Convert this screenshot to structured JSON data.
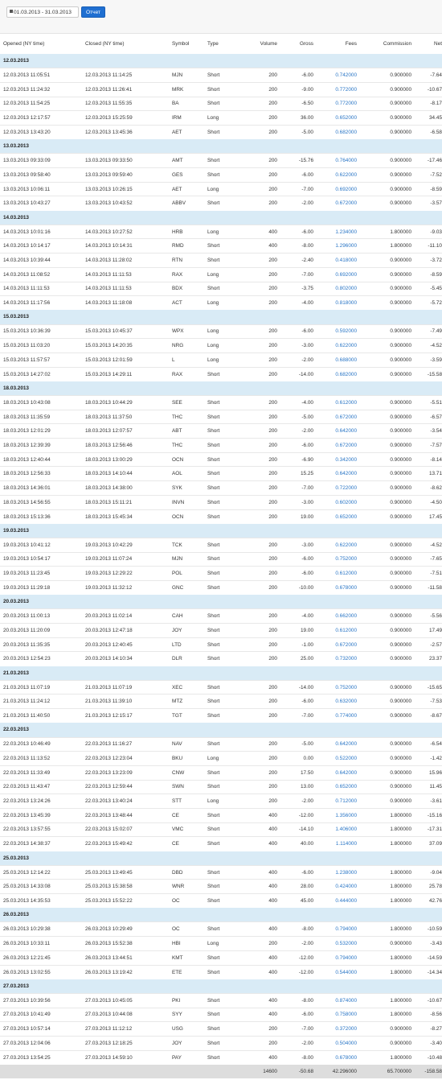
{
  "toolbar": {
    "date_range": "01.03.2013 - 31.03.2013",
    "report_label": "Отчет",
    "calendar_icon": "calendar-icon"
  },
  "headers": [
    "Opened (NY time)",
    "Closed (NY time)",
    "Symbol",
    "Type",
    "Volume",
    "Gross",
    "Fees",
    "Commission",
    "Net"
  ],
  "groups": [
    {
      "date": "12.03.2013",
      "rows": [
        [
          "12.03.2013 11:05:51",
          "12.03.2013 11:14:25",
          "MJN",
          "Short",
          "200",
          "-6.00",
          "0.742000",
          "0.900000",
          "-7.64"
        ],
        [
          "12.03.2013 11:24:32",
          "12.03.2013 11:26:41",
          "MRK",
          "Short",
          "200",
          "-9.00",
          "0.772000",
          "0.900000",
          "-10.67"
        ],
        [
          "12.03.2013 11:54:25",
          "12.03.2013 11:55:35",
          "BA",
          "Short",
          "200",
          "-6.50",
          "0.772000",
          "0.900000",
          "-8.17"
        ],
        [
          "12.03.2013 12:17:57",
          "12.03.2013 15:25:59",
          "IRM",
          "Long",
          "200",
          "36.00",
          "0.652000",
          "0.900000",
          "34.45"
        ],
        [
          "12.03.2013 13:43:20",
          "12.03.2013 13:45:36",
          "AET",
          "Short",
          "200",
          "-5.00",
          "0.682000",
          "0.900000",
          "-6.58"
        ]
      ]
    },
    {
      "date": "13.03.2013",
      "rows": [
        [
          "13.03.2013 09:33:09",
          "13.03.2013 09:33:50",
          "AMT",
          "Short",
          "200",
          "-15.76",
          "0.764000",
          "0.900000",
          "-17.46"
        ],
        [
          "13.03.2013 09:58:40",
          "13.03.2013 09:59:40",
          "GES",
          "Short",
          "200",
          "-6.00",
          "0.622000",
          "0.900000",
          "-7.52"
        ],
        [
          "13.03.2013 10:06:11",
          "13.03.2013 10:26:15",
          "AET",
          "Long",
          "200",
          "-7.00",
          "0.692000",
          "0.900000",
          "-8.59"
        ],
        [
          "13.03.2013 10:43:27",
          "13.03.2013 10:43:52",
          "ABBV",
          "Short",
          "200",
          "-2.00",
          "0.672000",
          "0.900000",
          "-3.57"
        ]
      ]
    },
    {
      "date": "14.03.2013",
      "rows": [
        [
          "14.03.2013 10:01:16",
          "14.03.2013 10:27:52",
          "HRB",
          "Long",
          "400",
          "-6.00",
          "1.234000",
          "1.800000",
          "-9.03"
        ],
        [
          "14.03.2013 10:14:17",
          "14.03.2013 10:14:31",
          "RMD",
          "Short",
          "400",
          "-8.00",
          "1.296000",
          "1.800000",
          "-11.10"
        ],
        [
          "14.03.2013 10:39:44",
          "14.03.2013 11:28:02",
          "RTN",
          "Short",
          "200",
          "-2.40",
          "0.418000",
          "0.900000",
          "-3.72"
        ],
        [
          "14.03.2013 11:08:52",
          "14.03.2013 11:11:53",
          "RAX",
          "Long",
          "200",
          "-7.00",
          "0.692000",
          "0.900000",
          "-8.59"
        ],
        [
          "14.03.2013 11:11:53",
          "14.03.2013 11:11:53",
          "BDX",
          "Short",
          "200",
          "-3.75",
          "0.802000",
          "0.900000",
          "-5.45"
        ],
        [
          "14.03.2013 11:17:56",
          "14.03.2013 11:18:08",
          "ACT",
          "Long",
          "200",
          "-4.00",
          "0.818000",
          "0.900000",
          "-5.72"
        ]
      ]
    },
    {
      "date": "15.03.2013",
      "rows": [
        [
          "15.03.2013 10:36:39",
          "15.03.2013 10:45:37",
          "WPX",
          "Long",
          "200",
          "-6.00",
          "0.592000",
          "0.900000",
          "-7.49"
        ],
        [
          "15.03.2013 11:03:20",
          "15.03.2013 14:20:35",
          "NRG",
          "Long",
          "200",
          "-3.00",
          "0.622000",
          "0.900000",
          "-4.52"
        ],
        [
          "15.03.2013 11:57:57",
          "15.03.2013 12:01:59",
          "L",
          "Long",
          "200",
          "-2.00",
          "0.688000",
          "0.900000",
          "-3.59"
        ],
        [
          "15.03.2013 14:27:02",
          "15.03.2013 14:29:11",
          "RAX",
          "Short",
          "200",
          "-14.00",
          "0.682000",
          "0.900000",
          "-15.58"
        ]
      ]
    },
    {
      "date": "18.03.2013",
      "rows": [
        [
          "18.03.2013 10:43:08",
          "18.03.2013 10:44:29",
          "SEE",
          "Short",
          "200",
          "-4.00",
          "0.612000",
          "0.900000",
          "-5.51"
        ],
        [
          "18.03.2013 11:35:59",
          "18.03.2013 11:37:50",
          "THC",
          "Short",
          "200",
          "-5.00",
          "0.672000",
          "0.900000",
          "-6.57"
        ],
        [
          "18.03.2013 12:01:29",
          "18.03.2013 12:07:57",
          "ABT",
          "Short",
          "200",
          "-2.00",
          "0.642000",
          "0.900000",
          "-3.54"
        ],
        [
          "18.03.2013 12:39:39",
          "18.03.2013 12:56:46",
          "THC",
          "Short",
          "200",
          "-6.00",
          "0.672000",
          "0.900000",
          "-7.57"
        ],
        [
          "18.03.2013 12:40:44",
          "18.03.2013 13:00:29",
          "OCN",
          "Short",
          "200",
          "-6.90",
          "0.342000",
          "0.900000",
          "-8.14"
        ],
        [
          "18.03.2013 12:56:33",
          "18.03.2013 14:10:44",
          "AOL",
          "Short",
          "200",
          "15.25",
          "0.642000",
          "0.900000",
          "13.71"
        ],
        [
          "18.03.2013 14:36:01",
          "18.03.2013 14:38:00",
          "SYK",
          "Short",
          "200",
          "-7.00",
          "0.722000",
          "0.900000",
          "-8.62"
        ],
        [
          "18.03.2013 14:56:55",
          "18.03.2013 15:11:21",
          "INVN",
          "Short",
          "200",
          "-3.00",
          "0.602000",
          "0.900000",
          "-4.50"
        ],
        [
          "18.03.2013 15:13:36",
          "18.03.2013 15:45:34",
          "OCN",
          "Short",
          "200",
          "19.00",
          "0.652000",
          "0.900000",
          "17.45"
        ]
      ]
    },
    {
      "date": "19.03.2013",
      "rows": [
        [
          "19.03.2013 10:41:12",
          "19.03.2013 10:42:29",
          "TCK",
          "Short",
          "200",
          "-3.00",
          "0.622000",
          "0.900000",
          "-4.52"
        ],
        [
          "19.03.2013 10:54:17",
          "19.03.2013 11:07:24",
          "MJN",
          "Short",
          "200",
          "-6.00",
          "0.752000",
          "0.900000",
          "-7.65"
        ],
        [
          "19.03.2013 11:23:45",
          "19.03.2013 12:29:22",
          "POL",
          "Short",
          "200",
          "-6.00",
          "0.612000",
          "0.900000",
          "-7.51"
        ],
        [
          "19.03.2013 11:29:18",
          "19.03.2013 11:32:12",
          "GNC",
          "Short",
          "200",
          "-10.00",
          "0.678000",
          "0.900000",
          "-11.58"
        ]
      ]
    },
    {
      "date": "20.03.2013",
      "rows": [
        [
          "20.03.2013 11:00:13",
          "20.03.2013 11:02:14",
          "CAH",
          "Short",
          "200",
          "-4.00",
          "0.662000",
          "0.900000",
          "-5.56"
        ],
        [
          "20.03.2013 11:20:09",
          "20.03.2013 12:47:18",
          "JOY",
          "Short",
          "200",
          "19.00",
          "0.612000",
          "0.900000",
          "17.49"
        ],
        [
          "20.03.2013 11:35:35",
          "20.03.2013 12:40:45",
          "LTD",
          "Short",
          "200",
          "-1.00",
          "0.672000",
          "0.900000",
          "-2.57"
        ],
        [
          "20.03.2013 12:54:23",
          "20.03.2013 14:10:34",
          "DLR",
          "Short",
          "200",
          "25.00",
          "0.732000",
          "0.900000",
          "23.37"
        ]
      ]
    },
    {
      "date": "21.03.2013",
      "rows": [
        [
          "21.03.2013 11:07:19",
          "21.03.2013 11:07:19",
          "XEC",
          "Short",
          "200",
          "-14.00",
          "0.752000",
          "0.900000",
          "-15.65"
        ],
        [
          "21.03.2013 11:24:12",
          "21.03.2013 11:39:10",
          "MTZ",
          "Short",
          "200",
          "-6.00",
          "0.632000",
          "0.900000",
          "-7.53"
        ],
        [
          "21.03.2013 11:40:50",
          "21.03.2013 12:15:17",
          "TGT",
          "Short",
          "200",
          "-7.00",
          "0.774000",
          "0.900000",
          "-8.67"
        ]
      ]
    },
    {
      "date": "22.03.2013",
      "rows": [
        [
          "22.03.2013 10:46:49",
          "22.03.2013 11:16:27",
          "NAV",
          "Short",
          "200",
          "-5.00",
          "0.642000",
          "0.900000",
          "-6.54"
        ],
        [
          "22.03.2013 11:13:52",
          "22.03.2013 12:23:04",
          "BKU",
          "Long",
          "200",
          "0.00",
          "0.522000",
          "0.900000",
          "-1.42"
        ],
        [
          "22.03.2013 11:33:49",
          "22.03.2013 13:23:09",
          "CNW",
          "Short",
          "200",
          "17.50",
          "0.642000",
          "0.900000",
          "15.96"
        ],
        [
          "22.03.2013 11:43:47",
          "22.03.2013 12:59:44",
          "SWN",
          "Short",
          "200",
          "13.00",
          "0.652000",
          "0.900000",
          "11.45"
        ],
        [
          "22.03.2013 13:24:26",
          "22.03.2013 13:40:24",
          "STT",
          "Long",
          "200",
          "-2.00",
          "0.712000",
          "0.900000",
          "-3.61"
        ],
        [
          "22.03.2013 13:45:39",
          "22.03.2013 13:48:44",
          "CE",
          "Short",
          "400",
          "-12.00",
          "1.356000",
          "1.800000",
          "-15.16"
        ],
        [
          "22.03.2013 13:57:55",
          "22.03.2013 15:02:07",
          "VMC",
          "Short",
          "400",
          "-14.10",
          "1.406000",
          "1.800000",
          "-17.31"
        ],
        [
          "22.03.2013 14:38:37",
          "22.03.2013 15:49:42",
          "CE",
          "Short",
          "400",
          "40.00",
          "1.114000",
          "1.800000",
          "37.09"
        ]
      ]
    },
    {
      "date": "25.03.2013",
      "rows": [
        [
          "25.03.2013 12:14:22",
          "25.03.2013 13:49:45",
          "DBD",
          "Short",
          "400",
          "-6.00",
          "1.238000",
          "1.800000",
          "-9.04"
        ],
        [
          "25.03.2013 14:33:08",
          "25.03.2013 15:38:58",
          "WNR",
          "Short",
          "400",
          "28.00",
          "0.424000",
          "1.800000",
          "25.78"
        ],
        [
          "25.03.2013 14:35:53",
          "25.03.2013 15:52:22",
          "OC",
          "Short",
          "400",
          "45.00",
          "0.444000",
          "1.800000",
          "42.76"
        ]
      ]
    },
    {
      "date": "26.03.2013",
      "rows": [
        [
          "26.03.2013 10:29:38",
          "26.03.2013 10:29:49",
          "OC",
          "Short",
          "400",
          "-8.00",
          "0.794000",
          "1.800000",
          "-10.59"
        ],
        [
          "26.03.2013 10:33:11",
          "26.03.2013 15:52:38",
          "HBI",
          "Long",
          "200",
          "-2.00",
          "0.532000",
          "0.900000",
          "-3.43"
        ],
        [
          "26.03.2013 12:21:45",
          "26.03.2013 13:44:51",
          "KMT",
          "Short",
          "400",
          "-12.00",
          "0.794000",
          "1.800000",
          "-14.59"
        ],
        [
          "26.03.2013 13:02:55",
          "26.03.2013 13:19:42",
          "ETE",
          "Short",
          "400",
          "-12.00",
          "0.544000",
          "1.800000",
          "-14.34"
        ]
      ]
    },
    {
      "date": "27.03.2013",
      "rows": [
        [
          "27.03.2013 10:39:56",
          "27.03.2013 10:45:05",
          "PKI",
          "Short",
          "400",
          "-8.00",
          "0.874000",
          "1.800000",
          "-10.67"
        ],
        [
          "27.03.2013 10:41:49",
          "27.03.2013 10:44:08",
          "SYY",
          "Short",
          "400",
          "-6.00",
          "0.758000",
          "1.800000",
          "-8.56"
        ],
        [
          "27.03.2013 10:57:14",
          "27.03.2013 11:12:12",
          "USG",
          "Short",
          "200",
          "-7.00",
          "0.372000",
          "0.900000",
          "-8.27"
        ],
        [
          "27.03.2013 12:04:06",
          "27.03.2013 12:18:25",
          "JOY",
          "Short",
          "200",
          "-2.00",
          "0.504000",
          "0.900000",
          "-3.40"
        ],
        [
          "27.03.2013 13:54:25",
          "27.03.2013 14:59:10",
          "PAY",
          "Short",
          "400",
          "-8.00",
          "0.678000",
          "1.800000",
          "-10.48"
        ]
      ]
    }
  ],
  "totals": {
    "volume": "14600",
    "gross": "-50.68",
    "fees": "42.296000",
    "commission": "65.700000",
    "net": "-158.58"
  }
}
